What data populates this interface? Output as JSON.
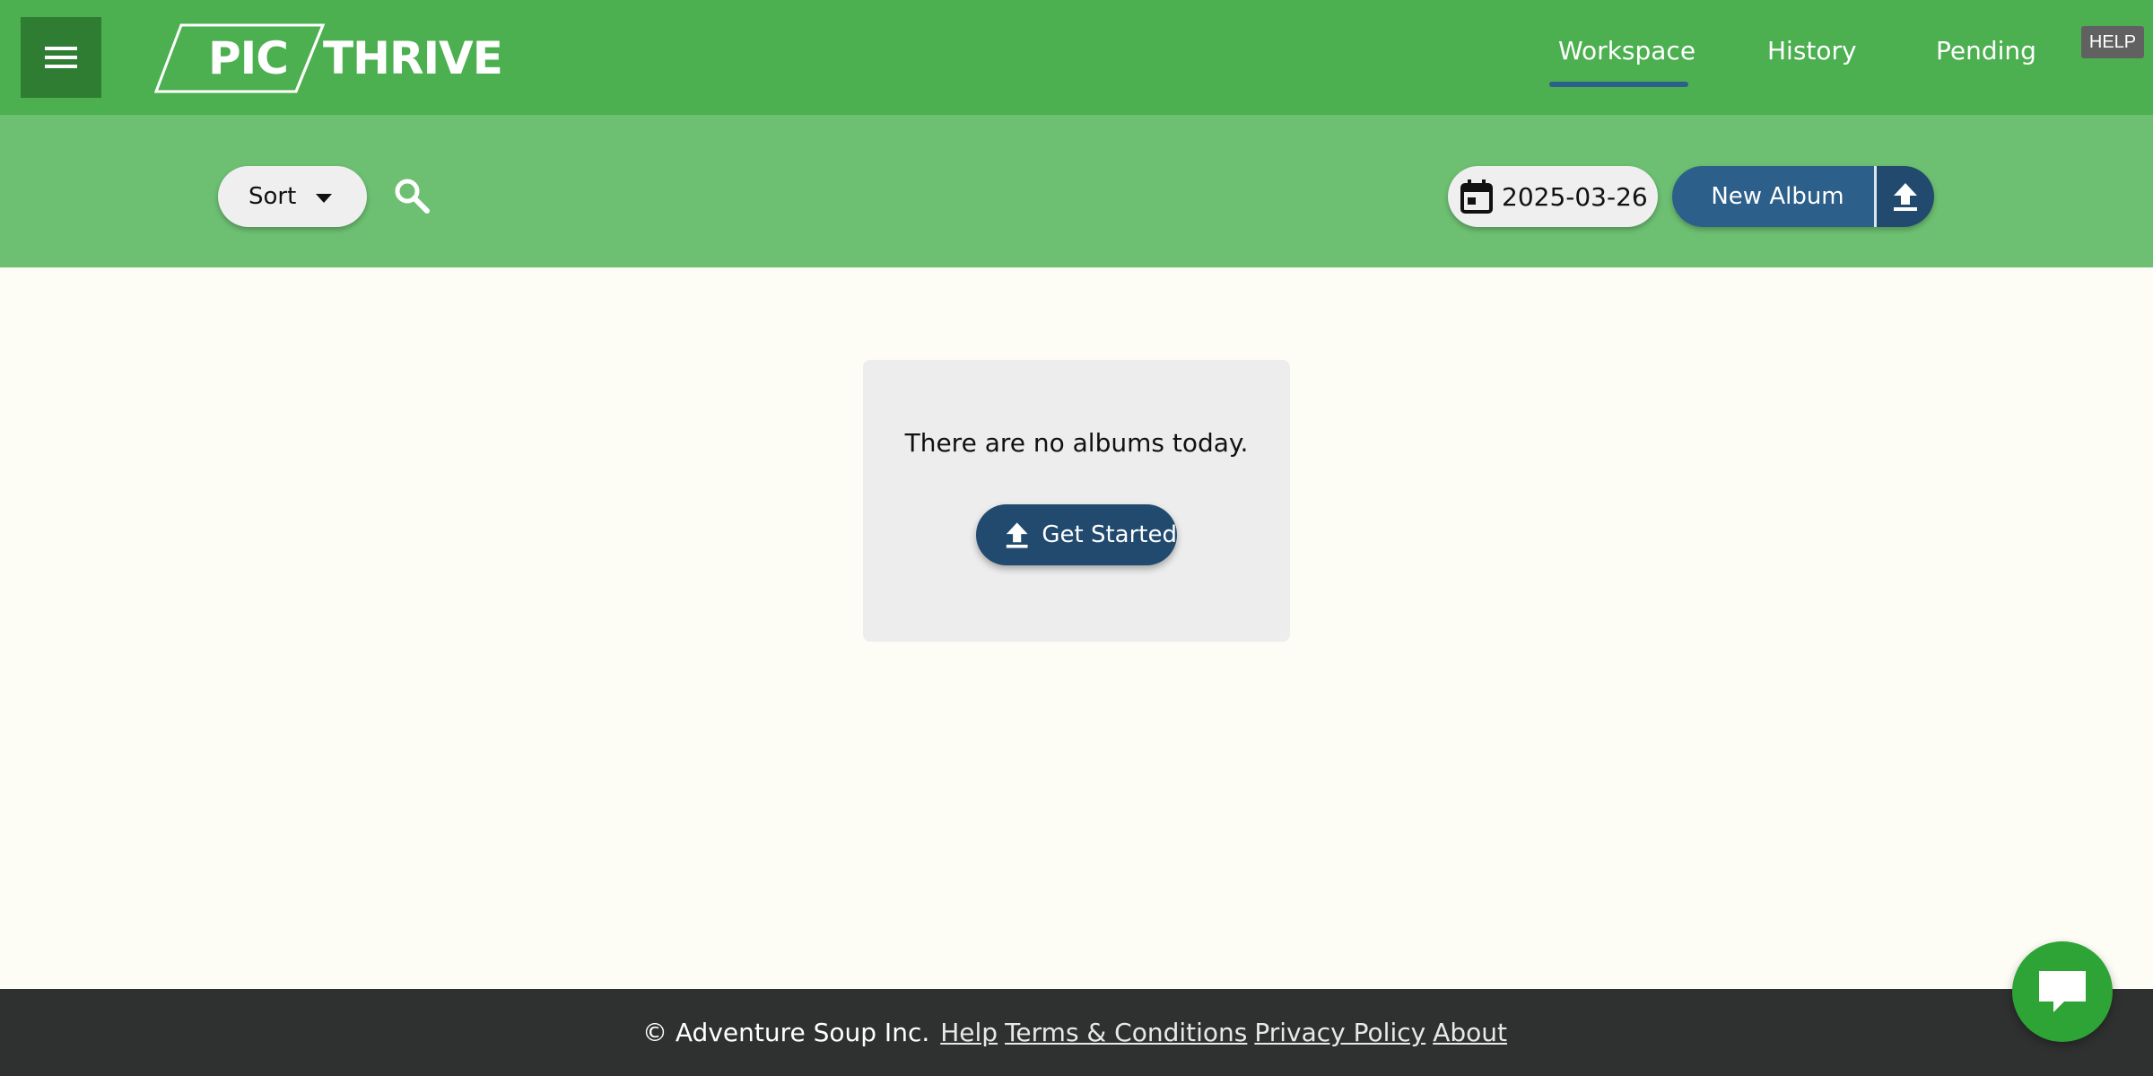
{
  "header": {
    "logo": {
      "left": "PIC",
      "right": "THRIVE"
    },
    "nav": [
      {
        "label": "Workspace",
        "active": true
      },
      {
        "label": "History",
        "active": false
      },
      {
        "label": "Pending",
        "active": false
      }
    ],
    "help_label": "HELP"
  },
  "toolbar": {
    "sort_label": "Sort",
    "date_value": "2025-03-26",
    "new_album_label": "New Album"
  },
  "main": {
    "empty_message": "There are no albums today.",
    "get_started_label": "Get Started"
  },
  "footer": {
    "copyright": "© Adventure Soup Inc.",
    "links": [
      "Help",
      "Terms & Conditions",
      "Privacy Policy",
      "About"
    ]
  },
  "colors": {
    "header_bg": "#4caf50",
    "subbar_bg": "#6dbf72",
    "primary_button": "#2c5f8a",
    "dark_button": "#214a6e",
    "footer_bg": "#2f3130",
    "chat_fab": "#2ea336"
  },
  "icons": {
    "menu": "hamburger-menu-icon",
    "search": "search-icon",
    "calendar": "calendar-icon",
    "upload": "upload-icon",
    "chat": "chat-bubble-icon",
    "sort_caret": "caret-down-icon"
  }
}
